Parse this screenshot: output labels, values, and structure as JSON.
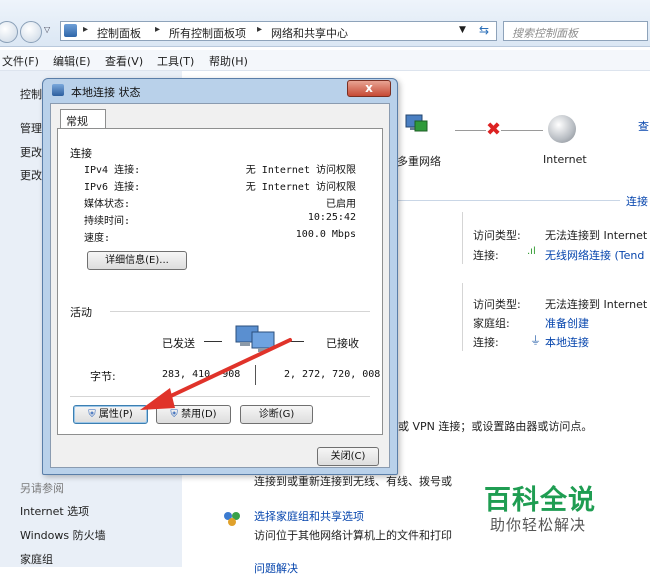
{
  "address": {
    "crumbs": [
      "控制面板",
      "所有控制面板项",
      "网络和共享中心"
    ],
    "search_placeholder": "搜索控制面板"
  },
  "menu": [
    "文件(F)",
    "编辑(E)",
    "查看(V)",
    "工具(T)",
    "帮助(H)"
  ],
  "left_pane": {
    "items": [
      "控制",
      "管理",
      "更改",
      "更改"
    ],
    "see_also": "另请参阅",
    "links": [
      "Internet 选项",
      "Windows 防火墙",
      "家庭组"
    ]
  },
  "network_map": {
    "multi_network": "多重网络",
    "internet": "Internet",
    "view_link": "查",
    "connect_link": "连接"
  },
  "networks": [
    {
      "access_label": "访问类型:",
      "access_value": "无法连接到 Internet",
      "conn_label": "连接:",
      "conn_value": "无线网络连接 (Tend"
    },
    {
      "access_label": "访问类型:",
      "access_value": "无法连接到 Internet",
      "homegroup_label": "家庭组:",
      "homegroup_value": "准备创建",
      "conn_label": "连接:",
      "conn_value": "本地连接"
    }
  ],
  "tasks": {
    "vpn_text": "或 VPN 连接；或设置路由器或访问点。",
    "reconnect_text": "连接到或重新连接到无线、有线、拨号或",
    "homegroup_link": "选择家庭组和共享选项",
    "homegroup_desc": "访问位于其他网络计算机上的文件和打印",
    "cutoff": "问题解决"
  },
  "dialog": {
    "title": "本地连接 状态",
    "close_x": "x",
    "tab": "常规",
    "connection_heading": "连接",
    "rows": [
      {
        "label": "IPv4 连接:",
        "value": "无 Internet 访问权限"
      },
      {
        "label": "IPv6 连接:",
        "value": "无 Internet 访问权限"
      },
      {
        "label": "媒体状态:",
        "value": "已启用"
      },
      {
        "label": "持续时间:",
        "value": "10:25:42"
      },
      {
        "label": "速度:",
        "value": "100.0 Mbps"
      }
    ],
    "details_button": "详细信息(E)...",
    "activity_heading": "活动",
    "sent_label": "已发送",
    "received_label": "已接收",
    "bytes_label": "字节:",
    "bytes_sent": "283, 410, 908",
    "bytes_received": "2, 272, 720, 008",
    "properties_button": "属性(P)",
    "disable_button": "禁用(D)",
    "diagnose_button": "诊断(G)",
    "close_button": "关闭(C)"
  },
  "watermark": {
    "main": "百科全说",
    "sub": "助你轻松解决"
  },
  "colors": {
    "arrow": "#e0332a",
    "link": "#0645ad",
    "watermark": "#1f9d52"
  }
}
